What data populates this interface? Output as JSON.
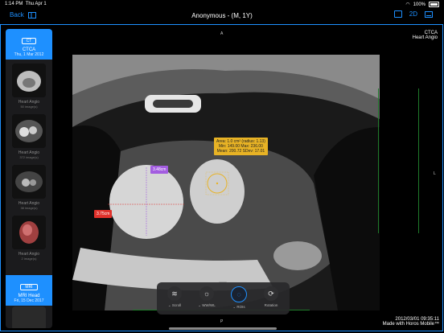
{
  "status_bar": {
    "time": "1:14 PM",
    "date": "Thu Apr 1",
    "battery": "100%"
  },
  "nav": {
    "back_label": "Back",
    "title": "Anonymous - (M, 1Y)",
    "mode": "2D"
  },
  "sidebar": {
    "ct_series": {
      "modality": "CT",
      "name": "CTCA",
      "date": "Thu, 1 Mar 2012"
    },
    "thumbnails": [
      {
        "label": "Heart Angio",
        "count": "50 image(s)"
      },
      {
        "label": "Heart Angio",
        "count": "372 image(s)"
      },
      {
        "label": "Heart Angio",
        "count": "38 image(s)"
      },
      {
        "label": "Heart Angio",
        "count": "2 image(s)"
      }
    ],
    "mri_series": {
      "modality": "MRI",
      "name": "MRI Head",
      "date": "Fri, 15 Dec 2017"
    }
  },
  "viewer": {
    "series_title": "CTCA",
    "series_subtitle": "Heart Angio",
    "orientation_top": "A",
    "orientation_right": "L",
    "orientation_bottom": "P",
    "footer_date": "2012/03/01 09:35:11",
    "footer_credit": "Made with Horos Mobile™",
    "measure_red": "3.75cm",
    "measure_purple": "3.48cm",
    "roi_line1": "Area: 1.0 cm² (radius: 1.13)",
    "roi_line2": "Min: 149.00 Max: 236.00",
    "roi_line3": "Mean: 200.72 SDev: 17.01"
  },
  "toolbar": {
    "tools": [
      {
        "label": "Scroll"
      },
      {
        "label": "WW/WL"
      },
      {
        "label": "ROIs"
      },
      {
        "label": "Rotation"
      }
    ]
  },
  "colors": {
    "accent": "#1e90ff",
    "roi_yellow": "#e8b325",
    "measure_red": "#e0312b",
    "measure_purple": "#a35de0"
  }
}
